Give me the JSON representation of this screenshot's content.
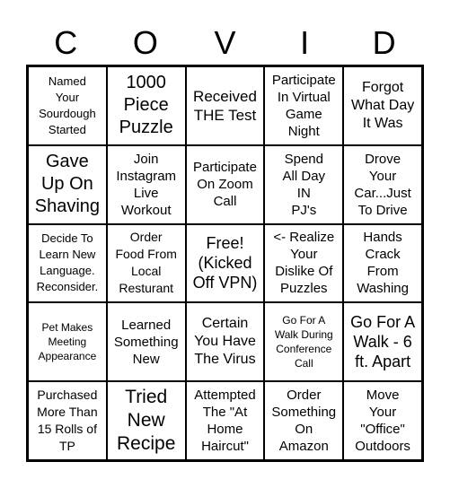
{
  "header": [
    "C",
    "O",
    "V",
    "I",
    "D"
  ],
  "cells": [
    "Named\nYour\nSourdough\nStarted",
    "1000\nPiece\nPuzzle",
    "Received\nTHE Test",
    "Participate\nIn Virtual\nGame\nNight",
    "Forgot\nWhat Day\nIt Was",
    "Gave\nUp On\nShaving",
    "Join\nInstagram\nLive\nWorkout",
    "Participate\nOn Zoom\nCall",
    "Spend\nAll Day\nIN\nPJ's",
    "Drove\nYour\nCar...Just\nTo Drive",
    "Decide To\nLearn New\nLanguage.\nReconsider.",
    "Order\nFood From\nLocal\nResturant",
    "Free!\n(Kicked\nOff VPN)",
    "<- Realize\nYour\nDislike Of\nPuzzles",
    "Hands\nCrack\nFrom\nWashing",
    "Pet Makes\nMeeting\nAppearance",
    "Learned\nSomething\nNew",
    "Certain\nYou Have\nThe Virus",
    "Go For A\nWalk During\nConference\nCall",
    "Go For A\nWalk - 6\nft. Apart",
    "Purchased\nMore Than\n15 Rolls of\nTP",
    "Tried\nNew\nRecipe",
    "Attempted\nThe \"At\nHome\nHaircut\"",
    "Order\nSomething\nOn\nAmazon",
    "Move\nYour\n\"Office\"\nOutdoors"
  ]
}
